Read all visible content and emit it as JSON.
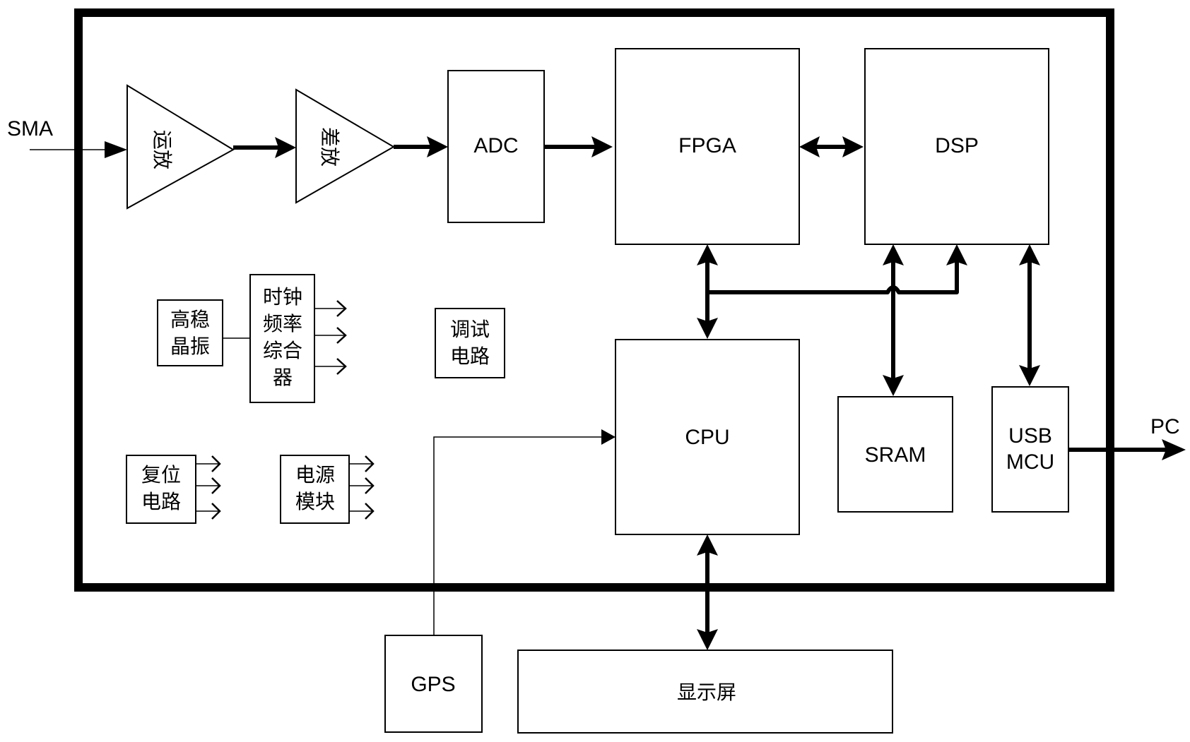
{
  "diagram": {
    "type": "hardware-block-diagram",
    "external_labels": {
      "input": "SMA",
      "output": "PC"
    },
    "blocks": {
      "opamp": "运放",
      "diffamp": "差放",
      "adc": "ADC",
      "fpga": "FPGA",
      "dsp": "DSP",
      "cpu": "CPU",
      "sram": "SRAM",
      "usb_mcu": [
        "USB",
        "MCU"
      ],
      "crystal": [
        "高稳",
        "晶振"
      ],
      "clock_synth": [
        "时钟",
        "频率",
        "综合",
        "器"
      ],
      "debug": [
        "调试",
        "电路"
      ],
      "reset": [
        "复位",
        "电路"
      ],
      "power": [
        "电源",
        "模块"
      ],
      "gps": "GPS",
      "display": "显示屏"
    },
    "connections": [
      {
        "from": "SMA",
        "to": "运放",
        "style": "thin",
        "direction": "one-way"
      },
      {
        "from": "运放",
        "to": "差放",
        "style": "thick",
        "direction": "one-way"
      },
      {
        "from": "差放",
        "to": "ADC",
        "style": "thick",
        "direction": "one-way"
      },
      {
        "from": "ADC",
        "to": "FPGA",
        "style": "thick",
        "direction": "one-way"
      },
      {
        "from": "FPGA",
        "to": "DSP",
        "style": "thick",
        "direction": "two-way"
      },
      {
        "from": "FPGA",
        "to": "CPU",
        "style": "thick",
        "direction": "two-way"
      },
      {
        "from": "bus",
        "to": "DSP",
        "style": "thick",
        "direction": "one-way"
      },
      {
        "from": "SRAM",
        "to": "DSP",
        "style": "thick",
        "direction": "two-way"
      },
      {
        "from": "USB MCU",
        "to": "DSP",
        "style": "thick",
        "direction": "two-way"
      },
      {
        "from": "USB MCU",
        "to": "PC",
        "style": "thick",
        "direction": "one-way"
      },
      {
        "from": "GPS",
        "to": "CPU",
        "style": "thin",
        "direction": "one-way"
      },
      {
        "from": "CPU",
        "to": "显示屏",
        "style": "thick",
        "direction": "two-way"
      },
      {
        "from": "高稳晶振",
        "to": "时钟频率综合器",
        "style": "thin",
        "direction": "none"
      }
    ]
  }
}
